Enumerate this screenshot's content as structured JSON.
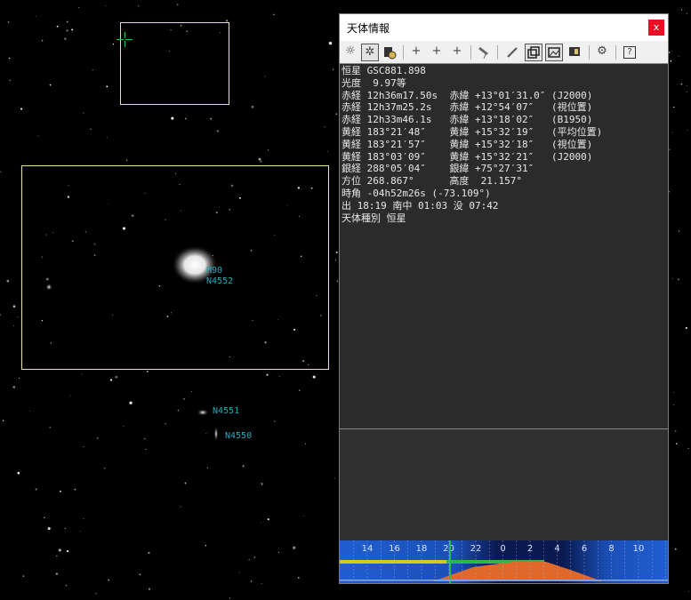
{
  "window": {
    "title": "天体情報",
    "close_label": "x"
  },
  "toolbar": {
    "icons": [
      "sun-icon",
      "star-icon",
      "objects-icon",
      "crosshair-icon",
      "crosshair-lock-icon",
      "crosshair-off-icon",
      "telescope-icon",
      "pencil-icon",
      "window-icon",
      "image-icon",
      "list-icon",
      "gear-icon",
      "help-icon"
    ],
    "help_label": "?"
  },
  "info": {
    "lines": [
      "恒星 GSC881.898",
      "光度  9.97等",
      "赤経 12h36m17.50s  赤緯 +13°01′31.0″ (J2000)",
      "赤経 12h37m25.2s   赤緯 +12°54′07″   (視位置)",
      "赤経 12h33m46.1s   赤緯 +13°18′02″   (B1950)",
      "黄経 183°21′48″    黄緯 +15°32′19″   (平均位置)",
      "黄経 183°21′57″    黄緯 +15°32′18″   (視位置)",
      "黄経 183°03′09″    黄緯 +15°32′21″   (J2000)",
      "銀経 288°05′04″    銀緯 +75°27′31″",
      "方位 268.867°      高度  21.157°",
      "時角 -04h52m26s (-73.109°)",
      "出 18:19 南中 01:03 没 07:42",
      "天体種別 恒星"
    ]
  },
  "sky": {
    "labels": {
      "m90": "M90",
      "n4552": "N4552",
      "n4551": "N4551",
      "n4550": "N4550"
    }
  },
  "timeline": {
    "hour_labels": [
      "14",
      "16",
      "18",
      "20",
      "22",
      "0",
      "2",
      "4",
      "6",
      "8",
      "10"
    ]
  },
  "colors": {
    "sky_background": "#000000",
    "frame_yellow": "#e8e6a0",
    "label_cyan": "#2aa6b8",
    "timeline_blue": "#1f5fd0",
    "altitude_orange": "#e0682a",
    "band_yellow": "#d4cc1a",
    "band_green": "#2bb84a",
    "close_red": "#e81123"
  }
}
